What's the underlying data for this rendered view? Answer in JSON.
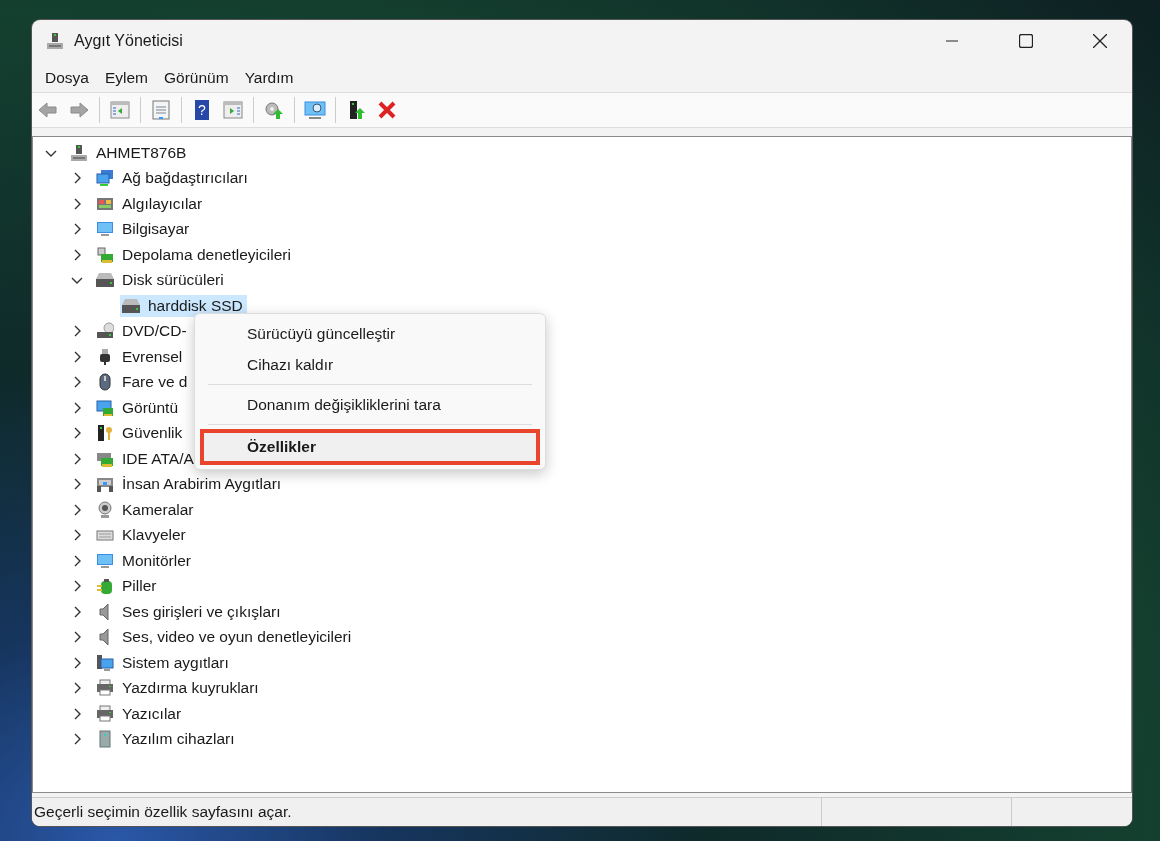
{
  "window": {
    "title": "Aygıt Yöneticisi"
  },
  "menu_bar": [
    {
      "label": "Dosya"
    },
    {
      "label": "Eylem"
    },
    {
      "label": "Görünüm"
    },
    {
      "label": "Yardım"
    }
  ],
  "toolbar": [
    {
      "kind": "back",
      "disabled": true
    },
    {
      "kind": "forward",
      "disabled": true
    },
    {
      "kind": "sep"
    },
    {
      "kind": "pane",
      "disabled": false
    },
    {
      "kind": "sep"
    },
    {
      "kind": "properties",
      "disabled": false
    },
    {
      "kind": "sep"
    },
    {
      "kind": "help",
      "glyph": "?",
      "disabled": false
    },
    {
      "kind": "actionpane",
      "disabled": false
    },
    {
      "kind": "sep"
    },
    {
      "kind": "update",
      "disabled": false
    },
    {
      "kind": "sep"
    },
    {
      "kind": "scan",
      "disabled": false
    },
    {
      "kind": "sep"
    },
    {
      "kind": "enable",
      "disabled": false
    },
    {
      "kind": "uninstall",
      "disabled": false
    }
  ],
  "tree": {
    "label": "AHMET876B",
    "kind": "computer-root",
    "expanded": true,
    "children": [
      {
        "label": "Ağ bağdaştırıcıları",
        "kind": "network",
        "expanded": false
      },
      {
        "label": "Algılayıcılar",
        "kind": "sensor",
        "expanded": false
      },
      {
        "label": "Bilgisayar",
        "kind": "monitor",
        "expanded": false
      },
      {
        "label": "Depolama denetleyicileri",
        "kind": "storage",
        "expanded": false
      },
      {
        "label": "Disk sürücüleri",
        "kind": "disk",
        "expanded": true,
        "children": [
          {
            "label": "harddisk SSD",
            "kind": "disk",
            "selected": true
          }
        ]
      },
      {
        "label": "DVD/CD-",
        "kind": "optical",
        "expanded": false
      },
      {
        "label": "Evrensel",
        "kind": "usb",
        "expanded": false
      },
      {
        "label": "Fare ve d",
        "kind": "mouse",
        "expanded": false
      },
      {
        "label": "Görüntü",
        "kind": "display",
        "expanded": false
      },
      {
        "label": "Güvenlik",
        "kind": "security",
        "expanded": false
      },
      {
        "label": "IDE ATA/A",
        "kind": "ide",
        "expanded": false
      },
      {
        "label": "İnsan Arabirim Aygıtları",
        "kind": "hid",
        "expanded": false
      },
      {
        "label": "Kameralar",
        "kind": "camera",
        "expanded": false
      },
      {
        "label": "Klavyeler",
        "kind": "keyboard",
        "expanded": false
      },
      {
        "label": "Monitörler",
        "kind": "monitor",
        "expanded": false
      },
      {
        "label": "Piller",
        "kind": "battery",
        "expanded": false
      },
      {
        "label": "Ses girişleri ve çıkışları",
        "kind": "audio",
        "expanded": false
      },
      {
        "label": "Ses, video ve oyun denetleyicileri",
        "kind": "audio",
        "expanded": false
      },
      {
        "label": "Sistem aygıtları",
        "kind": "system",
        "expanded": false
      },
      {
        "label": "Yazdırma kuyrukları",
        "kind": "printer",
        "expanded": false
      },
      {
        "label": "Yazıcılar",
        "kind": "printer",
        "expanded": false
      },
      {
        "label": "Yazılım cihazları",
        "kind": "software",
        "expanded": false
      }
    ]
  },
  "context_menu": [
    {
      "kind": "item",
      "label": "Sürücüyü güncelleştir",
      "selected": false
    },
    {
      "kind": "item",
      "label": "Cihazı kaldır",
      "selected": false
    },
    {
      "kind": "separator"
    },
    {
      "kind": "item",
      "label": "Donanım değişikliklerini tara",
      "selected": false
    },
    {
      "kind": "separator"
    },
    {
      "kind": "item",
      "label": "Özellikler",
      "selected": true
    }
  ],
  "status_bar": {
    "text": "Geçerli seçimin özellik sayfasını açar."
  }
}
